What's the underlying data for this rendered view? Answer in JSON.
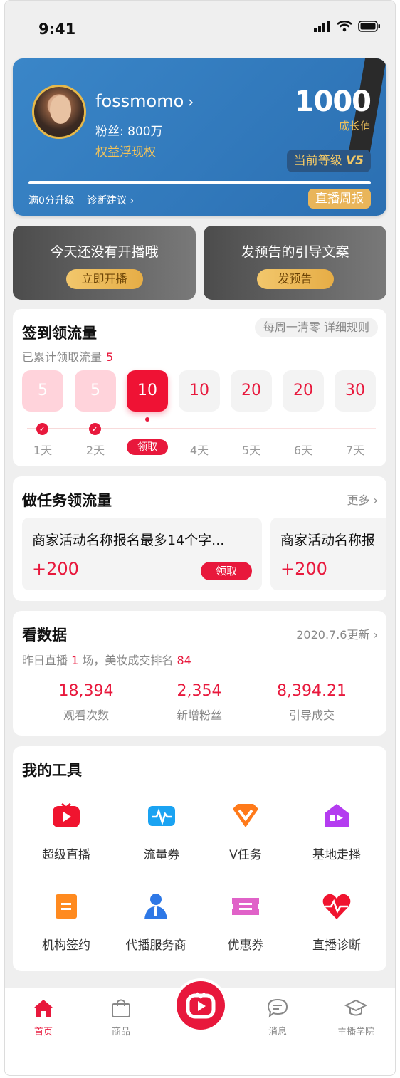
{
  "status_bar": {
    "time": "9:41"
  },
  "profile": {
    "name": "fossmomo",
    "fans_label": "粉丝: 800万",
    "rights": "权益浮现权",
    "score": "1000",
    "score_label": "成长值",
    "level_label": "当前等级",
    "level_value": "V5",
    "upgrade_hint": "满0分升级",
    "diagnosis_link": "诊断建议",
    "weekly_report": "直播周报",
    "progress": 1.0
  },
  "promos": [
    {
      "title": "今天还没有开播哦",
      "button": "立即开播"
    },
    {
      "title": "发预告的引导文案",
      "button": "发预告"
    }
  ],
  "checkin": {
    "title": "签到领流量",
    "rules": "每周一清零 详细规则",
    "accumulated_label": "已累计领取流量",
    "accumulated_value": "5",
    "days": [
      {
        "value": "5",
        "label": "1天",
        "state": "done"
      },
      {
        "value": "5",
        "label": "2天",
        "state": "done"
      },
      {
        "value": "10",
        "label": "领取",
        "state": "today"
      },
      {
        "value": "10",
        "label": "4天",
        "state": "future"
      },
      {
        "value": "20",
        "label": "5天",
        "state": "future"
      },
      {
        "value": "20",
        "label": "6天",
        "state": "future"
      },
      {
        "value": "30",
        "label": "7天",
        "state": "future"
      }
    ]
  },
  "tasks": {
    "title": "做任务领流量",
    "more": "更多",
    "items": [
      {
        "name": "商家活动名称报名最多14个字...",
        "reward": "+200",
        "button": "领取"
      },
      {
        "name": "商家活动名称报",
        "reward": "+200"
      }
    ]
  },
  "data": {
    "title": "看数据",
    "updated": "2020.7.6更新",
    "summary_1": "昨日直播",
    "live_count": "1",
    "summary_2": "场，美妆成交排名",
    "rank": "84",
    "stats": [
      {
        "value": "18,394",
        "label": "观看次数"
      },
      {
        "value": "2,354",
        "label": "新增粉丝"
      },
      {
        "value": "8,394.21",
        "label": "引导成交"
      }
    ]
  },
  "tools": {
    "title": "我的工具",
    "items": [
      {
        "label": "超级直播",
        "icon": "tv-play-icon",
        "color": "#f0142f"
      },
      {
        "label": "流量券",
        "icon": "pulse-ticket-icon",
        "color": "#1aa3f2"
      },
      {
        "label": "V任务",
        "icon": "v-badge-icon",
        "color": "#ff7a1a"
      },
      {
        "label": "基地走播",
        "icon": "house-play-icon",
        "color": "#b43cf0"
      },
      {
        "label": "机构签约",
        "icon": "document-icon",
        "color": "#ff8a1f"
      },
      {
        "label": "代播服务商",
        "icon": "agent-icon",
        "color": "#2e78e6"
      },
      {
        "label": "优惠券",
        "icon": "coupon-icon",
        "color": "#e062c8"
      },
      {
        "label": "直播诊断",
        "icon": "heart-pulse-icon",
        "color": "#f0142f"
      }
    ]
  },
  "tabbar": {
    "items": [
      {
        "label": "首页",
        "icon": "home-icon",
        "active": true
      },
      {
        "label": "商品",
        "icon": "bag-icon",
        "active": false
      },
      {
        "label": "消息",
        "icon": "chat-icon",
        "active": false
      },
      {
        "label": "主播学院",
        "icon": "graduation-cap-icon",
        "active": false
      }
    ],
    "center_icon": "live-camera-icon"
  },
  "colors": {
    "accent": "#e8183c",
    "profile_blue": "#2f78be",
    "gold": "#e9b55a"
  }
}
